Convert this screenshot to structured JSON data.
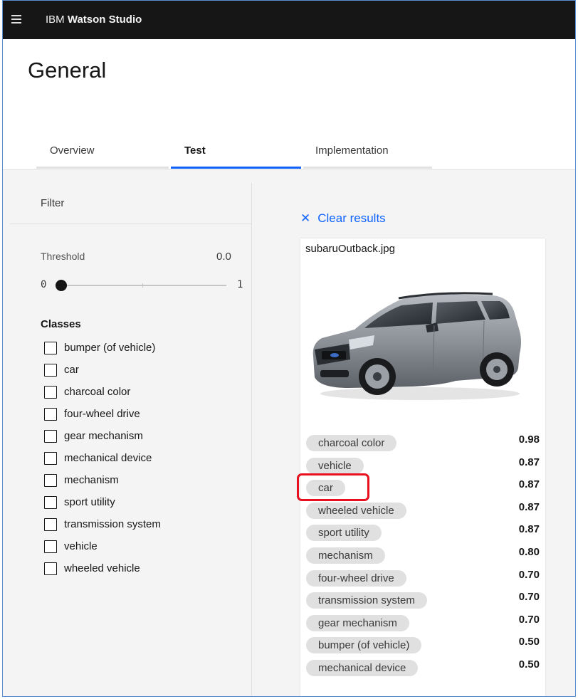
{
  "header": {
    "brand_prefix": "IBM",
    "brand_name": "Watson Studio"
  },
  "page": {
    "title": "General"
  },
  "tabs": [
    {
      "label": "Overview",
      "active": false
    },
    {
      "label": "Test",
      "active": true
    },
    {
      "label": "Implementation",
      "active": false
    }
  ],
  "filter": {
    "title": "Filter",
    "threshold_label": "Threshold",
    "threshold_value": "0.0",
    "slider_min": "0",
    "slider_max": "1",
    "classes_title": "Classes",
    "classes": [
      "bumper (of vehicle)",
      "car",
      "charcoal color",
      "four-wheel drive",
      "gear mechanism",
      "mechanical device",
      "mechanism",
      "sport utility",
      "transmission system",
      "vehicle",
      "wheeled vehicle"
    ]
  },
  "results": {
    "clear_label": "Clear results",
    "filename": "subaruOutback.jpg",
    "image_alt": "Subaru Outback car",
    "items": [
      {
        "label": "charcoal color",
        "score": "0.98"
      },
      {
        "label": "vehicle",
        "score": "0.87"
      },
      {
        "label": "car",
        "score": "0.87"
      },
      {
        "label": "wheeled vehicle",
        "score": "0.87"
      },
      {
        "label": "sport utility",
        "score": "0.87"
      },
      {
        "label": "mechanism",
        "score": "0.80"
      },
      {
        "label": "four-wheel drive",
        "score": "0.70"
      },
      {
        "label": "transmission system",
        "score": "0.70"
      },
      {
        "label": "gear mechanism",
        "score": "0.70"
      },
      {
        "label": "bumper (of vehicle)",
        "score": "0.50"
      },
      {
        "label": "mechanical device",
        "score": "0.50"
      }
    ],
    "highlighted_label": "car"
  },
  "colors": {
    "accent": "#0f62fe",
    "topbar": "#161616",
    "highlight": "#e8101e",
    "pill": "#e0e0e0"
  }
}
